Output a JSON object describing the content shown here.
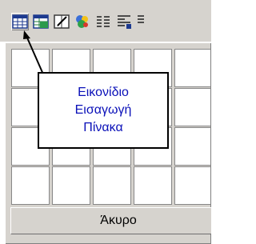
{
  "toolbar": {
    "buttons": [
      {
        "name": "insert-table-icon",
        "icon": "table-grid-icon",
        "pressed": true
      },
      {
        "name": "insert-excel-icon",
        "icon": "spreadsheet-icon"
      },
      {
        "name": "drawing-icon",
        "icon": "frame-pen-icon"
      },
      {
        "name": "tables-borders-icon",
        "icon": "puzzle-icon"
      },
      {
        "name": "columns-icon",
        "icon": "columns-icon"
      },
      {
        "name": "document-map-icon",
        "icon": "document-map-icon"
      }
    ]
  },
  "grid": {
    "rows": 4,
    "columns": 5
  },
  "cancel_button": {
    "label": "Άκυρο"
  },
  "tooltip": {
    "lines": [
      "Εικονίδιο",
      "Εισαγωγή",
      "Πίνακα"
    ]
  },
  "colors": {
    "toolbar_bg": "#d6d3ce",
    "tooltip_text": "#0a10b8",
    "grid_cell": "#ffffff"
  }
}
